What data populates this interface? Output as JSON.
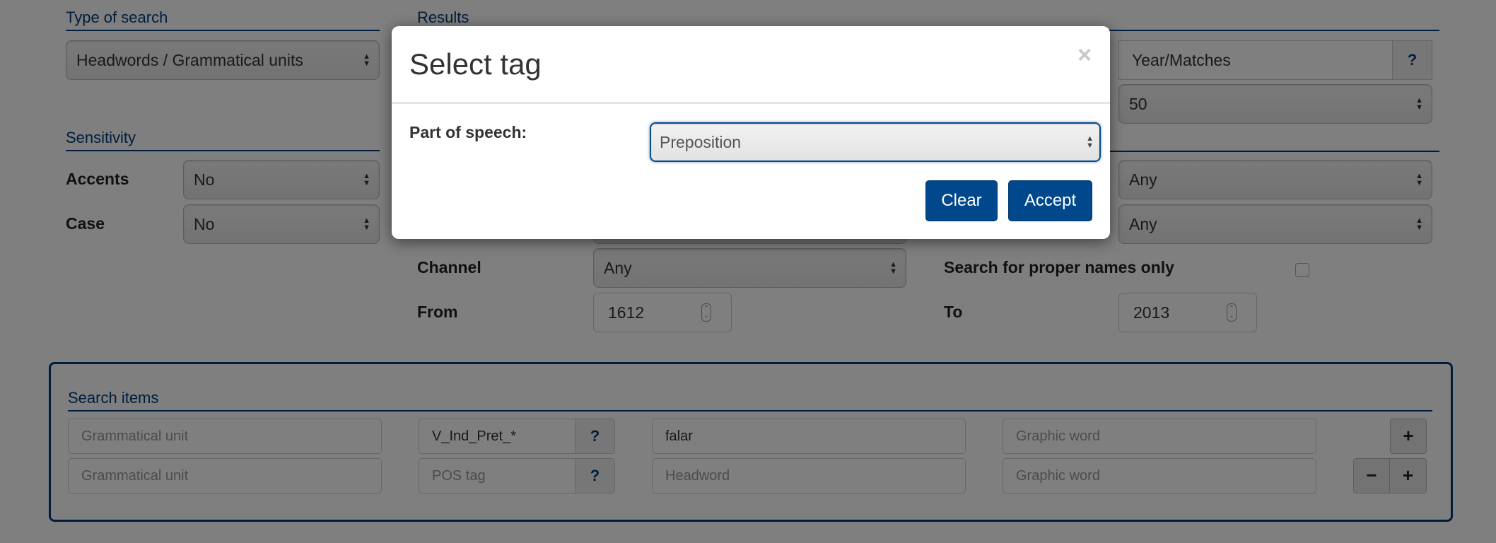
{
  "type_of_search": {
    "title": "Type of search",
    "select_value": "Headwords / Grammatical units"
  },
  "results": {
    "title": "Results",
    "order_value": "Year/Matches",
    "help_label": "?",
    "per_page_value": "50"
  },
  "sensitivity": {
    "title": "Sensitivity",
    "accents_label": "Accents",
    "accents_value": "No",
    "case_label": "Case",
    "case_value": "No"
  },
  "filters": {
    "right_select_1_value": "Any",
    "right_select_2_value": "Any",
    "channel_label": "Channel",
    "channel_value": "Any",
    "proper_names_label": "Search for proper names only",
    "proper_names_checked": false,
    "from_label": "From",
    "from_value": "1612",
    "to_label": "To",
    "to_value": "2013"
  },
  "search_items": {
    "title": "Search items",
    "help_label": "?",
    "add_label": "+",
    "remove_label": "−",
    "rows": [
      {
        "grammatical_unit_placeholder": "Grammatical unit",
        "pos_tag_value": "V_Ind_Pret_*",
        "headword_value": "falar",
        "graphic_word_placeholder": "Graphic word"
      },
      {
        "grammatical_unit_placeholder": "Grammatical unit",
        "pos_tag_placeholder": "POS tag",
        "headword_placeholder": "Headword",
        "graphic_word_placeholder": "Graphic word"
      }
    ]
  },
  "modal": {
    "title": "Select tag",
    "close_label": "×",
    "pos_label": "Part of speech:",
    "pos_value": "Preposition",
    "clear_label": "Clear",
    "accept_label": "Accept"
  },
  "icons": {
    "select_arrows": "▲▼",
    "spinner": "⌃⌄"
  },
  "colors": {
    "brand_blue": "#003b7a",
    "button_blue": "#00488b"
  }
}
